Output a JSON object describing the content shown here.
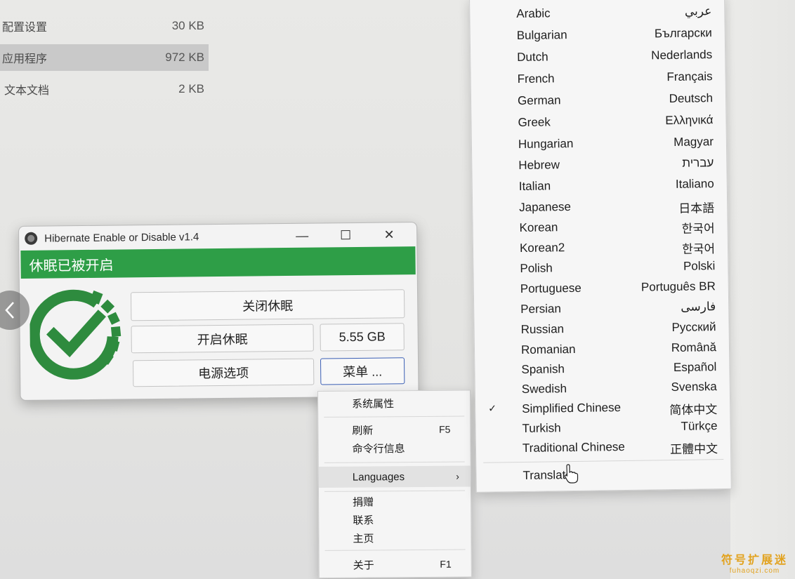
{
  "explorer": {
    "files": [
      {
        "name": "配置设置",
        "size": "30 KB"
      },
      {
        "name": "应用程序",
        "size": "972 KB",
        "selected": true
      },
      {
        "name": "文本文档",
        "size": "2 KB"
      }
    ]
  },
  "window": {
    "title": "Hibernate Enable or Disable v1.4",
    "status": "休眠已被开启",
    "status_color": "#2e9e47",
    "buttons": {
      "disable": "关闭休眠",
      "enable": "开启休眠",
      "size": "5.55 GB",
      "power": "电源选项",
      "menu": "菜单 ..."
    },
    "controls": {
      "minimize": "—",
      "maximize": "☐",
      "close": "✕"
    }
  },
  "context_menu": {
    "system_properties": "系统属性",
    "refresh": "刷新",
    "refresh_key": "F5",
    "cmdline": "命令行信息",
    "languages": "Languages",
    "donate": "捐赠",
    "contact": "联系",
    "homepage": "主页",
    "about": "关于",
    "about_key": "F1"
  },
  "languages": {
    "items": [
      {
        "en": "Arabic",
        "native": "عربي"
      },
      {
        "en": "Bulgarian",
        "native": "Български"
      },
      {
        "en": "Dutch",
        "native": "Nederlands"
      },
      {
        "en": "French",
        "native": "Français"
      },
      {
        "en": "German",
        "native": "Deutsch"
      },
      {
        "en": "Greek",
        "native": "Ελληνικά"
      },
      {
        "en": "Hungarian",
        "native": "Magyar"
      },
      {
        "en": "Hebrew",
        "native": "עברית"
      },
      {
        "en": "Italian",
        "native": "Italiano"
      },
      {
        "en": "Japanese",
        "native": "日本語"
      },
      {
        "en": "Korean",
        "native": "한국어"
      },
      {
        "en": "Korean2",
        "native": "한국어"
      },
      {
        "en": "Polish",
        "native": "Polski"
      },
      {
        "en": "Portuguese",
        "native": "Português BR"
      },
      {
        "en": "Persian",
        "native": "فارسی"
      },
      {
        "en": "Russian",
        "native": "Русский"
      },
      {
        "en": "Romanian",
        "native": "Română"
      },
      {
        "en": "Spanish",
        "native": "Español"
      },
      {
        "en": "Swedish",
        "native": "Svenska"
      },
      {
        "en": "Simplified Chinese",
        "native": "简体中文",
        "checked": true
      },
      {
        "en": "Turkish",
        "native": "Türkçe"
      },
      {
        "en": "Traditional Chinese",
        "native": "正體中文"
      }
    ],
    "translate": "Translate",
    "check_mark": "✓"
  },
  "watermark": {
    "line1": "符号扩展迷",
    "line2": "fuhaoqzi.com"
  }
}
